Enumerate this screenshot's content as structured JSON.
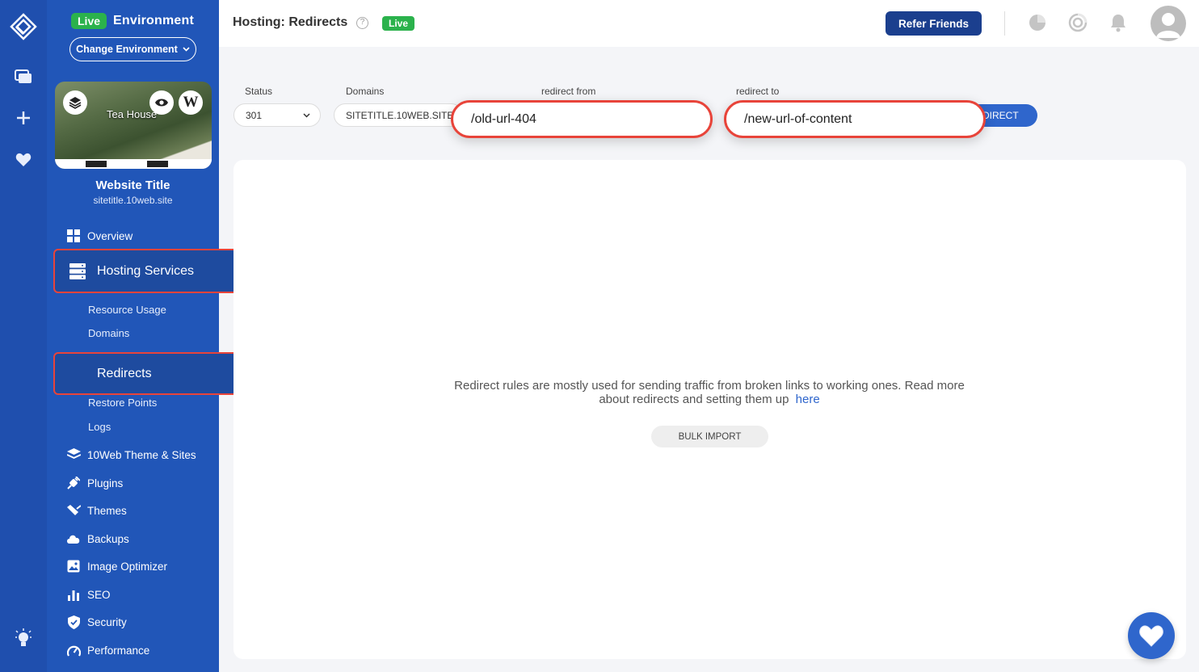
{
  "sidebar": {
    "live_badge": "Live",
    "environment_label": "Environment",
    "change_env_label": "Change Environment",
    "thumbnail_text": "Tea House",
    "site_title": "Website Title",
    "site_url": "sitetitle.10web.site",
    "items": [
      {
        "label": "Overview",
        "icon": "grid-icon"
      },
      {
        "label": "Hosting Services",
        "icon": "server-icon"
      },
      {
        "label": "10Web Theme & Sites",
        "icon": "layers-icon"
      },
      {
        "label": "Plugins",
        "icon": "plug-icon"
      },
      {
        "label": "Themes",
        "icon": "brush-icon"
      },
      {
        "label": "Backups",
        "icon": "cloud-icon"
      },
      {
        "label": "Image Optimizer",
        "icon": "image-icon"
      },
      {
        "label": "SEO",
        "icon": "bar-chart-icon"
      },
      {
        "label": "Security",
        "icon": "shield-icon"
      },
      {
        "label": "Performance",
        "icon": "gauge-icon"
      }
    ],
    "sub_items": [
      "Resource Usage",
      "Domains",
      "Redirects",
      "Restore Points",
      "Logs"
    ]
  },
  "header": {
    "title": "Hosting: Redirects",
    "live_badge": "Live",
    "refer_label": "Refer Friends"
  },
  "form": {
    "status_label": "Status",
    "status_value": "301",
    "domains_label": "Domains",
    "domains_value": "SITETITLE.10WEB.SITE",
    "redirect_from_label": "redirect from",
    "redirect_from_value": "/old-url-404",
    "redirect_to_label": "redirect to",
    "redirect_to_value": "/new-url-of-content",
    "add_button_partial": "DIRECT"
  },
  "content": {
    "info_text": "Redirect rules are mostly used for sending traffic from broken links to working ones. Read more about redirects and setting them up",
    "info_link": "here",
    "bulk_import": "BULK IMPORT"
  },
  "colors": {
    "sidebar_bg": "#2156b8",
    "rail_bg": "#1f4fae",
    "highlight_border": "#e8443a",
    "accent": "#2f66cc",
    "live_green": "#2bb24c"
  }
}
